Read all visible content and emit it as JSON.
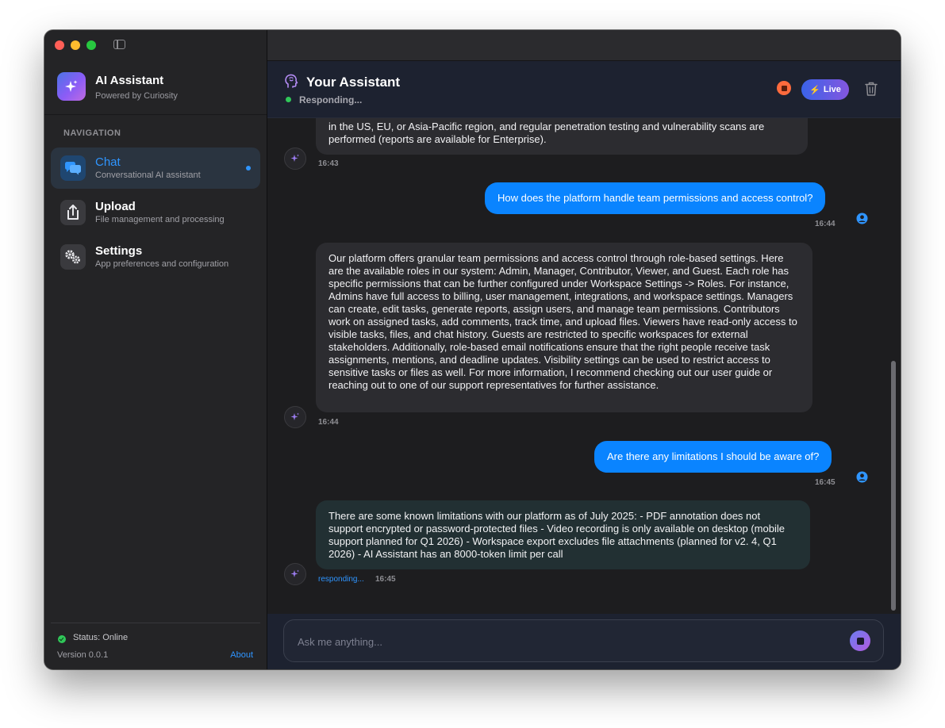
{
  "window": {
    "traffic_lights": [
      "close",
      "minimize",
      "zoom"
    ]
  },
  "brand": {
    "title": "AI Assistant",
    "subtitle": "Powered by Curiosity"
  },
  "nav": {
    "heading": "NAVIGATION",
    "items": [
      {
        "title": "Chat",
        "description": "Conversational AI assistant",
        "icon": "chat-bubbles-icon",
        "active": true
      },
      {
        "title": "Upload",
        "description": "File management and processing",
        "icon": "upload-icon",
        "active": false
      },
      {
        "title": "Settings",
        "description": "App preferences and configuration",
        "icon": "gears-icon",
        "active": false
      }
    ]
  },
  "sidebar_footer": {
    "status": "Status: Online",
    "version": "Version 0.0.1",
    "about": "About"
  },
  "header": {
    "title": "Your Assistant",
    "status": "Responding...",
    "live_label": "Live"
  },
  "messages": [
    {
      "role": "assistant",
      "text": "in the US, EU, or Asia-Pacific region, and regular penetration testing and vulnerability scans are performed (reports are available for Enterprise).",
      "time": "16:43"
    },
    {
      "role": "user",
      "text": "How does the platform handle team permissions and access control?",
      "time": "16:44"
    },
    {
      "role": "assistant",
      "text": "Our platform offers granular team permissions and access control through role-based settings. Here are the available roles in our system: Admin, Manager, Contributor, Viewer, and Guest. Each role has specific permissions that can be further configured under Workspace Settings -> Roles. For instance, Admins have full access to billing, user management, integrations, and workspace settings. Managers can create, edit tasks, generate reports, assign users, and manage team permissions. Contributors work on assigned tasks, add comments, track time, and upload files. Viewers have read-only access to visible tasks, files, and chat history. Guests are restricted to specific workspaces for external stakeholders. Additionally, role-based email notifications ensure that the right people receive task assignments, mentions, and deadline updates. Visibility settings can be used to restrict access to sensitive tasks or files as well. For more information, I recommend checking out our user guide or reaching out to one of our support representatives for further assistance.",
      "time": "16:44"
    },
    {
      "role": "user",
      "text": "Are there any limitations I should be aware of?",
      "time": "16:45"
    },
    {
      "role": "assistant",
      "text": "There are some known limitations with our platform as of July 2025: - PDF annotation does not support encrypted or password-protected files - Video recording is only available on desktop (mobile support planned for Q1 2026) - Workspace export excludes file attachments (planned for v2. 4, Q1 2026) - AI Assistant has an 8000-token limit per call",
      "time": "16:45",
      "status": "responding..."
    }
  ],
  "composer": {
    "placeholder": "Ask me anything..."
  },
  "colors": {
    "accent": "#0a84ff",
    "online": "#30c759",
    "stop": "#ff6b3d"
  }
}
